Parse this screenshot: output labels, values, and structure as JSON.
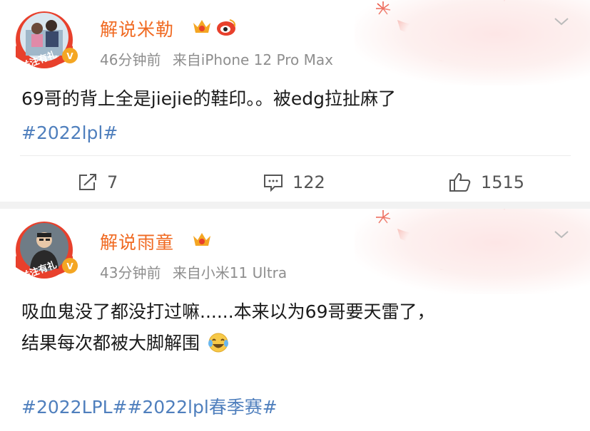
{
  "posts": [
    {
      "username": "解说米勒",
      "time": "46分钟前",
      "source": "来自iPhone 12 Pro Max",
      "follow_label": "关注有礼",
      "text": "69哥的背上全是jiejie的鞋印。。被edg拉扯麻了",
      "hashtags": "#2022lpl#",
      "repost_count": "7",
      "comment_count": "122",
      "like_count": "1515"
    },
    {
      "username": "解说雨童",
      "time": "43分钟前",
      "source": "来自小米11 Ultra",
      "follow_label": "关注有礼",
      "text_line1": "吸血鬼没了都没打过嘛......本来以为69哥要天雷了，",
      "text_line2": "结果每次都被大脚解围",
      "emoji": "crying-laughing-emoji",
      "hashtags": "#2022LPL##2022lpl春季赛#"
    }
  ],
  "colors": {
    "username": "#f06a22",
    "hashtag": "#4f7fbd",
    "meta": "#8e8e8e",
    "follow_ring": "#e8402c"
  },
  "icons": [
    "repost-icon",
    "comment-icon",
    "like-icon",
    "chevron-down-icon",
    "vip-crown-icon",
    "weibo-badge-icon",
    "tiger-mascot-icon",
    "lantern-icon"
  ]
}
